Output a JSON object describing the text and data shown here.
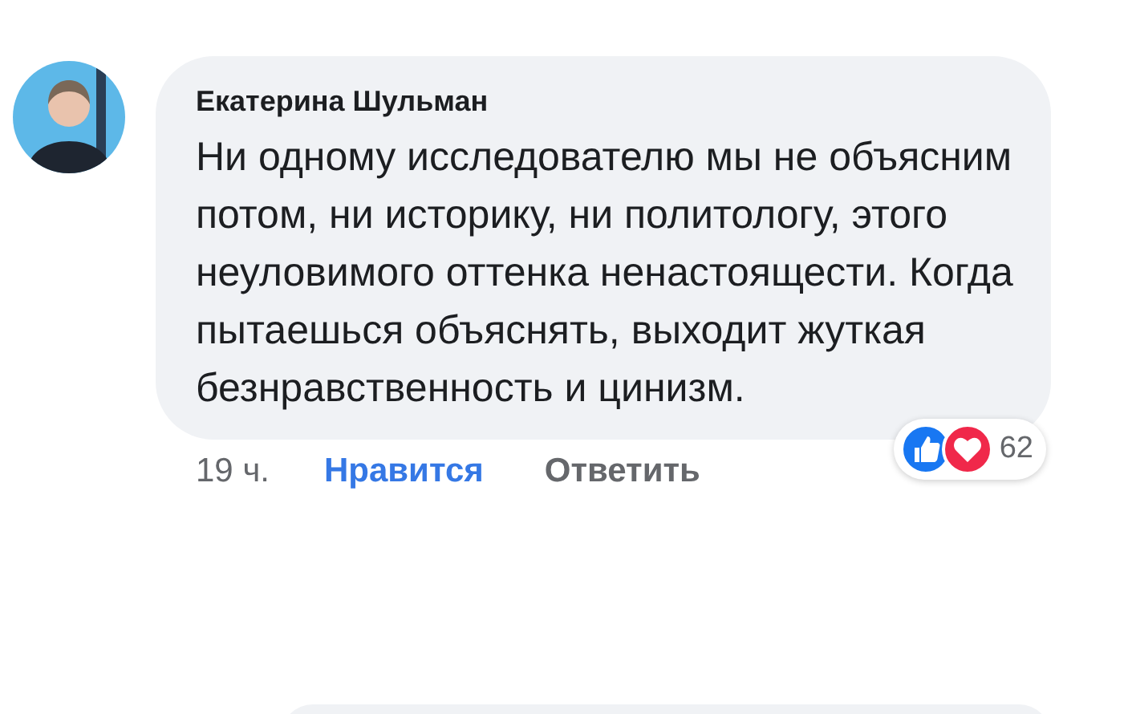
{
  "comment": {
    "author": "Екатерина Шульман",
    "text": "Ни одному исследователю мы не объясним потом, ни историку, ни политологу, этого неуловимого оттенка ненастоящести. Когда пытаешься объяснять, выходит жуткая безнравственность и цинизм.",
    "time": "19 ч.",
    "actions": [
      {
        "label": "Нравится",
        "kind": "like"
      },
      {
        "label": "Ответить",
        "kind": "reply"
      }
    ],
    "reactions": [
      {
        "kind": "like"
      },
      {
        "kind": "love"
      }
    ],
    "reaction_count": "62"
  }
}
